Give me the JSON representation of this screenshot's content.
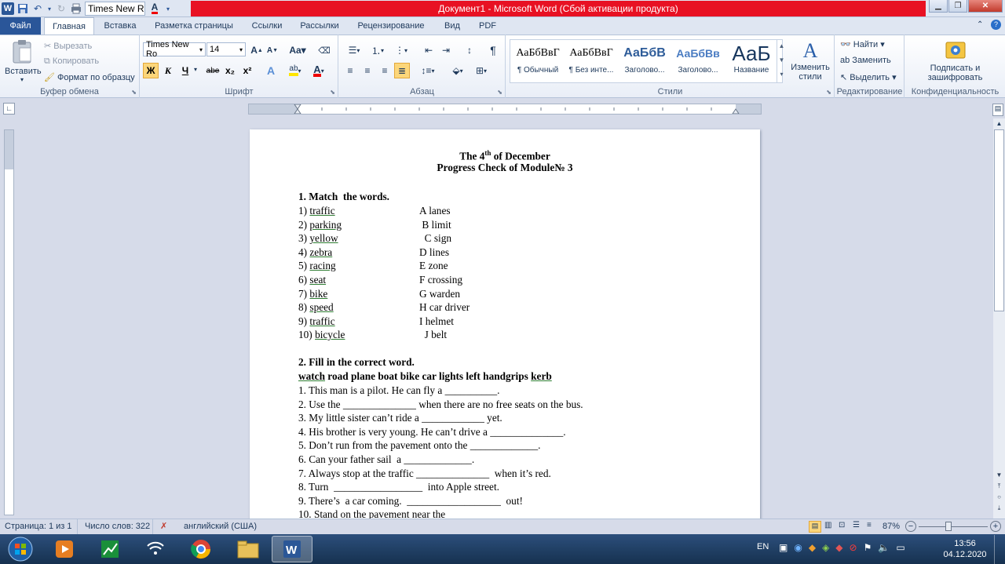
{
  "window": {
    "title": "Документ1  -  Microsoft Word (Сбой активации продукта)",
    "qat_font": "Times New Ro"
  },
  "tabs": [
    "Файл",
    "Главная",
    "Вставка",
    "Разметка страницы",
    "Ссылки",
    "Рассылки",
    "Рецензирование",
    "Вид",
    "PDF"
  ],
  "ribbon": {
    "clipboard": {
      "paste": "Вставить",
      "cut": "Вырезать",
      "copy": "Копировать",
      "format_painter": "Формат по образцу",
      "label": "Буфер обмена"
    },
    "font": {
      "name": "Times New Ro",
      "size": "14",
      "bold": "Ж",
      "italic": "К",
      "underline": "Ч",
      "strike": "abe",
      "sub": "x₂",
      "sup": "x²",
      "label": "Шрифт"
    },
    "paragraph": {
      "label": "Абзац"
    },
    "styles": {
      "items": [
        {
          "preview": "АаБбВвГ",
          "name": "¶ Обычный"
        },
        {
          "preview": "АаБбВвГ",
          "name": "¶ Без инте..."
        },
        {
          "preview": "АаБбВ",
          "name": "Заголово..."
        },
        {
          "preview": "АаБбВв",
          "name": "Заголово..."
        },
        {
          "preview": "АаБ",
          "name": "Название"
        }
      ],
      "change": "Изменить стили",
      "label": "Стили"
    },
    "editing": {
      "find": "Найти",
      "replace": "Заменить",
      "select": "Выделить",
      "label": "Редактирование"
    },
    "privacy": {
      "sign": "Подписать и зашифровать",
      "label": "Конфиденциальность"
    }
  },
  "document": {
    "title_pre": "The 4",
    "title_sup": "th",
    "title_post": " of December",
    "subtitle": "Progress Check of Module№ 3",
    "task1_heading": "1. Match  the words.",
    "task1_left": [
      {
        "num": "1) ",
        "word": "traffic"
      },
      {
        "num": "2) ",
        "word": "parking"
      },
      {
        "num": "3) ",
        "word": "yellow"
      },
      {
        "num": "4) ",
        "word": "zebra"
      },
      {
        "num": "5) ",
        "word": "racing"
      },
      {
        "num": "6) ",
        "word": "seat"
      },
      {
        "num": "7) ",
        "word": "bike"
      },
      {
        "num": "8) ",
        "word": "speed"
      },
      {
        "num": "9) ",
        "word": "traffic"
      },
      {
        "num": "10) ",
        "word": "bicycle"
      }
    ],
    "task1_right": [
      "A lanes",
      " B limit",
      "  C sign",
      "D lines",
      "E zone",
      "F crossing",
      "G warden",
      "H car driver",
      "I helmet",
      "  J belt"
    ],
    "task2_heading": "2. Fill in the correct word.",
    "task2_words_first": "watch",
    "task2_words_mid": " road plane boat bike car lights left handgrips ",
    "task2_words_last": "kerb",
    "task2_items": [
      "1. This man is a pilot. He can fly a __________.",
      "2. Use the ______________ when there are no free seats on the bus.",
      "3. My little sister can’t ride a ____________ yet.",
      "4. His brother is very young. He can’t drive a ______________.",
      "5. Don’t run from the pavement onto the _____________.",
      "6. Can your father sail  a _____________.",
      "7. Always stop at the traffic ______________  when it’s red.",
      "8. Turn  _________________  into Apple street.",
      "9. There’s  a car coming.  __________________  out!",
      "10. Stand on the pavement near the"
    ]
  },
  "status": {
    "page": "Страница: 1 из 1",
    "words": "Число слов: 322",
    "lang": "английский (США)",
    "zoom": "87%"
  },
  "taskbar": {
    "lang": "EN",
    "time": "13:56",
    "date": "04.12.2020"
  }
}
